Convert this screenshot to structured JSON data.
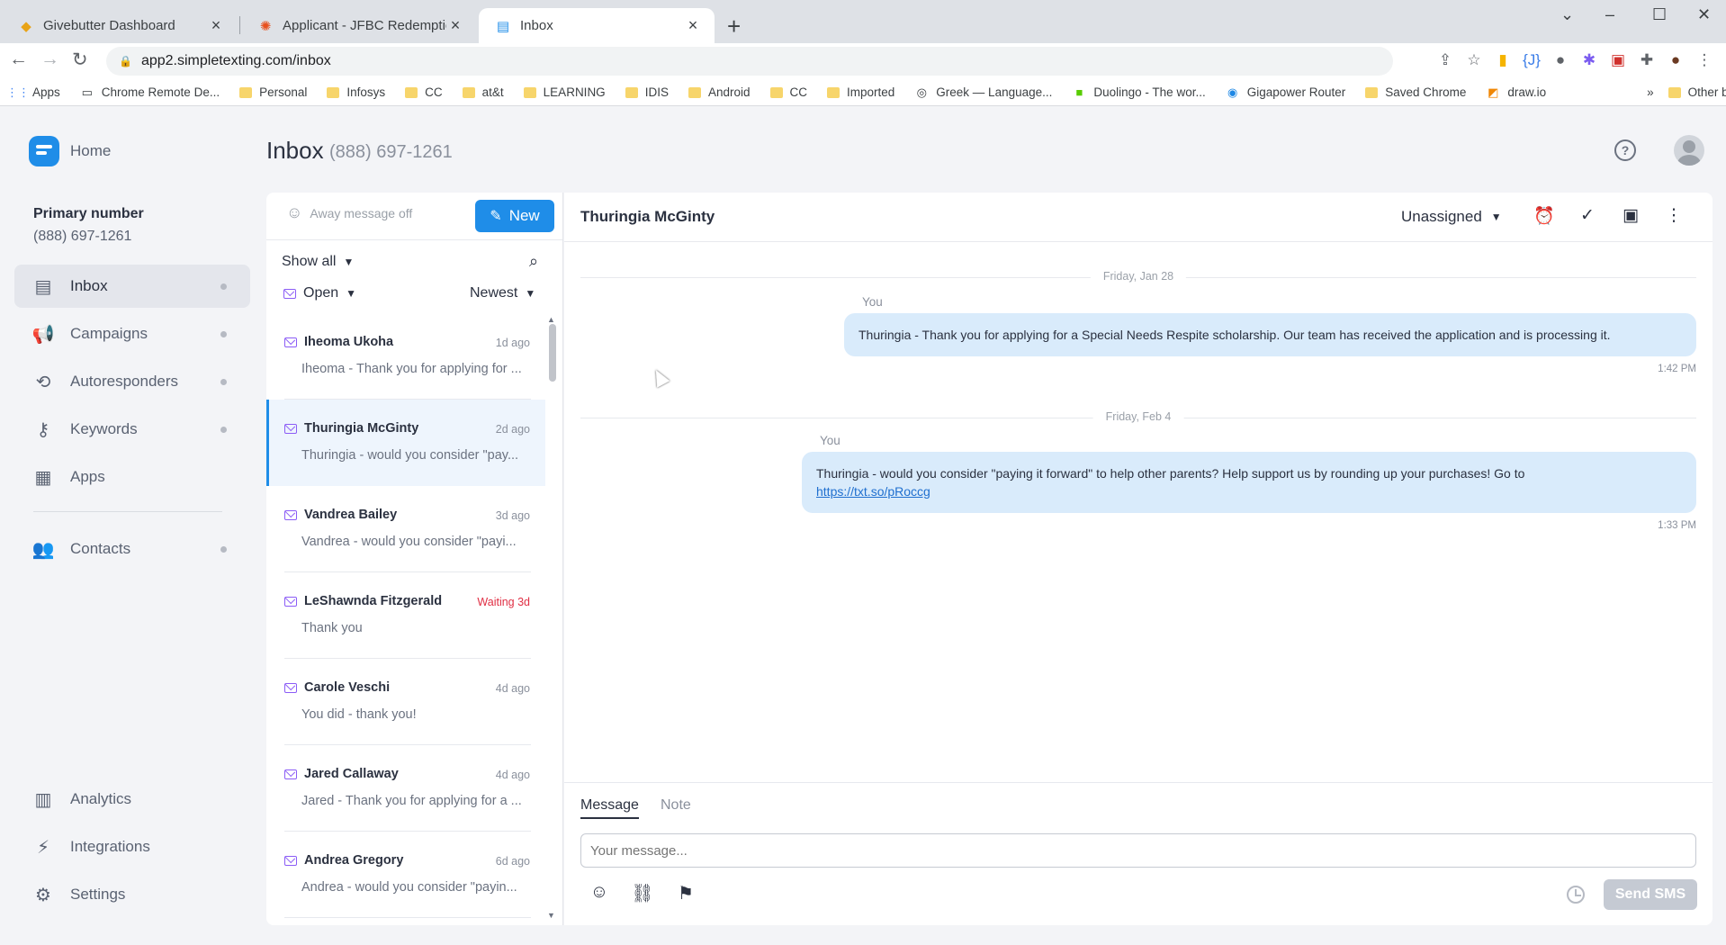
{
  "browser": {
    "tabs": [
      {
        "title": "Givebutter Dashboard",
        "icon": "givebutter-icon"
      },
      {
        "title": "Applicant - JFBC Redemption to",
        "icon": "zoho-icon"
      },
      {
        "title": "Inbox",
        "icon": "simpletexting-icon"
      }
    ],
    "url": "app2.simpletexting.com/inbox",
    "bookmarks": [
      "Apps",
      "Chrome Remote De...",
      "Personal",
      "Infosys",
      "CC",
      "at&t",
      "LEARNING",
      "IDIS",
      "Android",
      "CC",
      "Imported",
      "Greek — Language...",
      "Duolingo - The wor...",
      "Gigapower Router",
      "Saved Chrome",
      "draw.io"
    ],
    "other_bookmarks": "Other bookmarks",
    "overflow": "»"
  },
  "app": {
    "home": "Home",
    "primary_number_label": "Primary number",
    "primary_number": "(888) 697-1261",
    "nav": {
      "inbox": "Inbox",
      "campaigns": "Campaigns",
      "autoresponders": "Autoresponders",
      "keywords": "Keywords",
      "apps": "Apps",
      "contacts": "Contacts",
      "analytics": "Analytics",
      "integrations": "Integrations",
      "settings": "Settings"
    },
    "page_title": "Inbox",
    "page_phone": "(888) 697-1261"
  },
  "list": {
    "away_message": "Away message off",
    "new_button": "New",
    "show_filter": "Show all",
    "status_filter": "Open",
    "sort": "Newest",
    "conversations": [
      {
        "name": "Iheoma Ukoha",
        "time": "1d ago",
        "preview": "Iheoma - Thank you for applying for ..."
      },
      {
        "name": "Thuringia McGinty",
        "time": "2d ago",
        "preview": "Thuringia - would you consider \"pay..."
      },
      {
        "name": "Vandrea Bailey",
        "time": "3d ago",
        "preview": "Vandrea - would you consider \"payi..."
      },
      {
        "name": "LeShawnda Fitzgerald",
        "time": "Waiting 3d",
        "preview": "Thank you"
      },
      {
        "name": "Carole Veschi",
        "time": "4d ago",
        "preview": "You did - thank you!"
      },
      {
        "name": "Jared Callaway",
        "time": "4d ago",
        "preview": "Jared - Thank you for applying for a ..."
      },
      {
        "name": "Andrea Gregory",
        "time": "6d ago",
        "preview": "Andrea - would you consider \"payin..."
      }
    ]
  },
  "conversation": {
    "contact": "Thuringia McGinty",
    "assignee": "Unassigned",
    "messages": [
      {
        "date": "Friday, Jan 28",
        "sender": "You",
        "text": "Thuringia  - Thank you for applying for a Special Needs Respite scholarship.  Our team has received the application and is processing it.",
        "time": "1:42 PM"
      },
      {
        "date": "Friday, Feb 4",
        "sender": "You",
        "text": "Thuringia - would you consider \"paying it forward\" to help other parents?  Help support us by rounding up your purchases! Go to",
        "link": "https://txt.so/pRoccg",
        "time": "1:33 PM"
      }
    ],
    "composer": {
      "tab_message": "Message",
      "tab_note": "Note",
      "placeholder": "Your message...",
      "send": "Send SMS"
    }
  },
  "colors": {
    "accent": "#1f8de8",
    "bubble": "#d9ebfb",
    "warning": "#e02f44",
    "open_icon": "#8b5cf6"
  }
}
